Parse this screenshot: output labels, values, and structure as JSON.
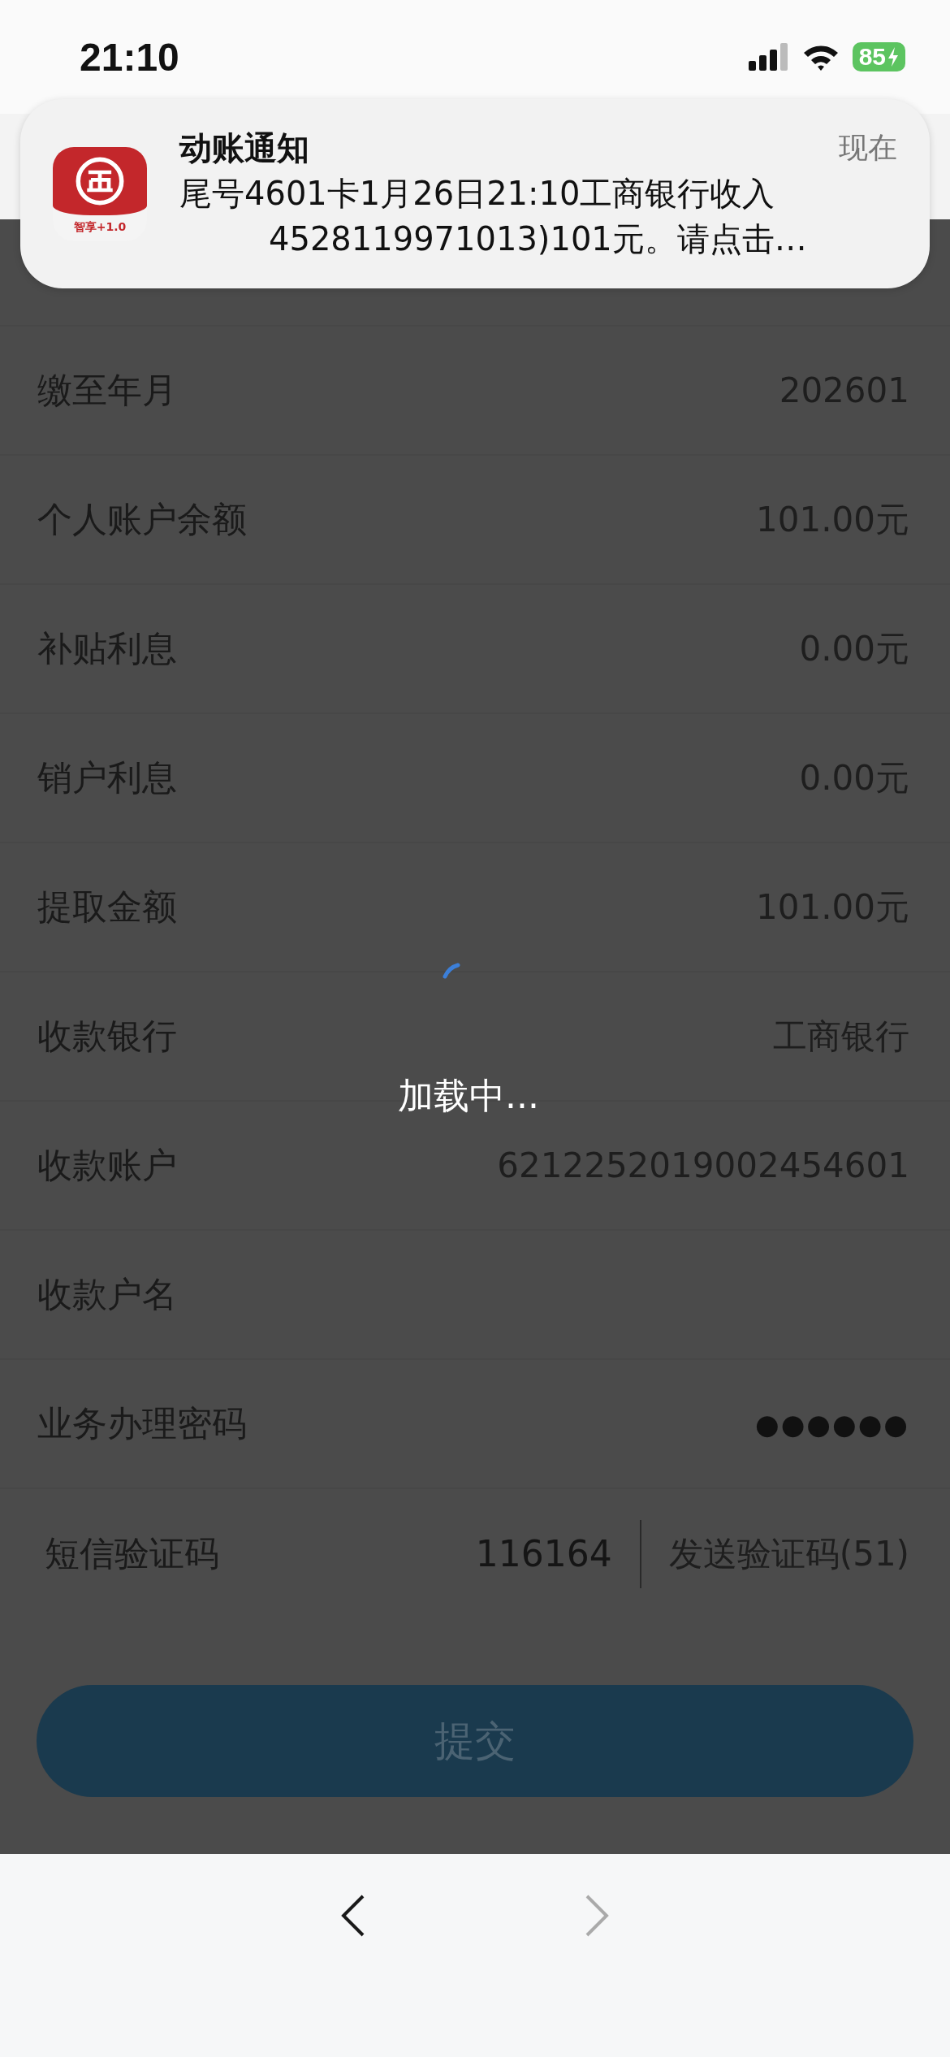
{
  "status_bar": {
    "time": "21:10",
    "battery": "85"
  },
  "notification": {
    "app_badge": "智享+1.0",
    "title": "动账通知",
    "time": "现在",
    "lines": [
      "尾号4601卡1月26日21:10工商银行收入",
      "4528119971013)101元。请点击…"
    ]
  },
  "fields": [
    {
      "label": "缴至年月",
      "value": "202601",
      "kind": "text"
    },
    {
      "label": "个人账户余额",
      "value": "101.00元",
      "kind": "text"
    },
    {
      "label": "补贴利息",
      "value": "0.00元",
      "kind": "text"
    },
    {
      "label": "销户利息",
      "value": "0.00元",
      "kind": "text"
    },
    {
      "label": "提取金额",
      "value": "101.00元",
      "kind": "text"
    },
    {
      "label": "收款银行",
      "value": "工商银行",
      "kind": "text"
    },
    {
      "label": "收款账户",
      "value": "6212252019002454601",
      "kind": "text"
    },
    {
      "label": "收款户名",
      "kind": "hidden"
    },
    {
      "label": "业务办理密码",
      "value": "●●●●●●",
      "kind": "password"
    }
  ],
  "sms": {
    "label": "短信验证码",
    "value": "116164",
    "button": "发送验证码(51)"
  },
  "submit": "提交",
  "loading": "加载中...",
  "nav": {
    "back_enabled": true,
    "forward_enabled": false
  }
}
